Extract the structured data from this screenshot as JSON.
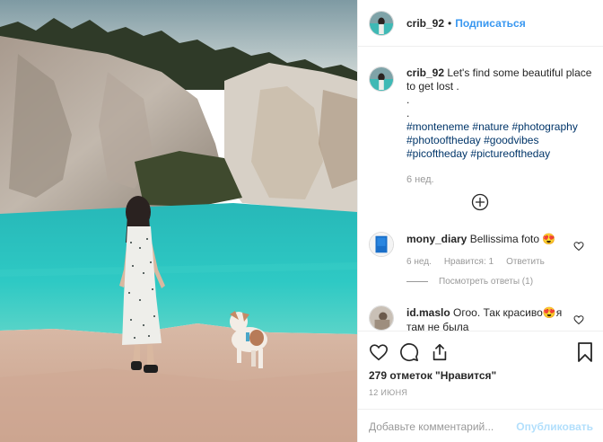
{
  "header": {
    "username": "crib_92",
    "separator": "•",
    "follow_label": "Подписаться"
  },
  "caption": {
    "username": "crib_92",
    "text": "Let's find some beautiful place to get lost .",
    "dot1": ".",
    "dot2": ".",
    "hashtags": [
      "#monteneme",
      "#nature",
      "#photography",
      "#photooftheday",
      "#goodvibes",
      "#picoftheday",
      "#pictureoftheday"
    ],
    "time": "6 нед."
  },
  "comments": [
    {
      "username": "mony_diary",
      "text": "Bellissima foto 😍",
      "time": "6 нед.",
      "likes_label": "Нравится: 1",
      "reply_label": "Ответить",
      "view_replies": "Посмотреть ответы (1)"
    },
    {
      "username": "id.maslo",
      "text": "Огоо. Так красиво😍я там не была"
    }
  ],
  "actions": {
    "like_icon": "heart-icon",
    "comment_icon": "comment-icon",
    "share_icon": "share-icon",
    "save_icon": "bookmark-icon",
    "likes_text": "279 отметок \"Нравится\"",
    "date": "12 ИЮНЯ"
  },
  "add_comment": {
    "placeholder": "Добавьте комментарий...",
    "publish_label": "Опубликовать"
  },
  "colors": {
    "link": "#3897f0",
    "hashtag": "#003569",
    "muted": "#999999",
    "publish_disabled": "#b2dffc",
    "water": "#2ec4c4"
  }
}
